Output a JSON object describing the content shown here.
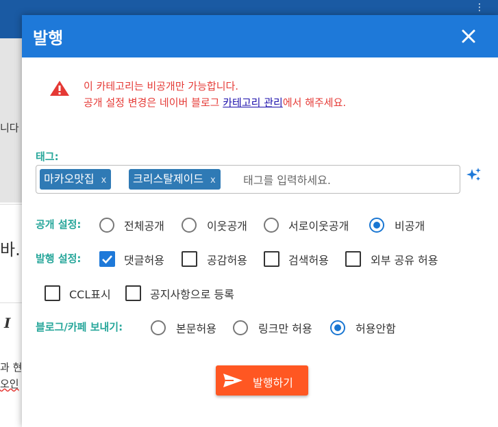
{
  "background": {
    "fragments": [
      "니다",
      "바.",
      "I",
      "과 현",
      "오인"
    ]
  },
  "dialog": {
    "title": "발행",
    "close_icon": "close-icon"
  },
  "alert": {
    "line1": "이 카테고리는 비공개만 가능합니다.",
    "line2_prefix": "공개 설정 변경은 네이버 블로그 ",
    "line2_link": "카테고리 관리",
    "line2_suffix": "에서 해주세요."
  },
  "tags": {
    "label": "태그:",
    "chips": [
      {
        "text": "마카오맛집",
        "remove": "x"
      },
      {
        "text": "크리스탈제이드",
        "remove": "x"
      }
    ],
    "placeholder": "태그를 입력하세요."
  },
  "visibility": {
    "label": "공개 설정:",
    "options": [
      "전체공개",
      "이웃공개",
      "서로이웃공개",
      "비공개"
    ],
    "selected": "비공개"
  },
  "publish_settings": {
    "label": "발행 설정:",
    "options": [
      {
        "label": "댓글허용",
        "checked": true
      },
      {
        "label": "공감허용",
        "checked": false
      },
      {
        "label": "검색허용",
        "checked": false
      },
      {
        "label": "외부 공유 허용",
        "checked": false
      },
      {
        "label": "CCL표시",
        "checked": false
      },
      {
        "label": "공지사항으로 등록",
        "checked": false
      }
    ]
  },
  "cafe_send": {
    "label": "블로그/카페 보내기:",
    "options": [
      "본문허용",
      "링크만 허용",
      "허용안함"
    ],
    "selected": "허용안함"
  },
  "publish_button": {
    "label": "발행하기"
  },
  "colors": {
    "header": "#1e79d9",
    "alert_text": "#e53935",
    "label_teal": "#26a69a",
    "chip": "#2f7ab5",
    "publish": "#ff5722"
  }
}
